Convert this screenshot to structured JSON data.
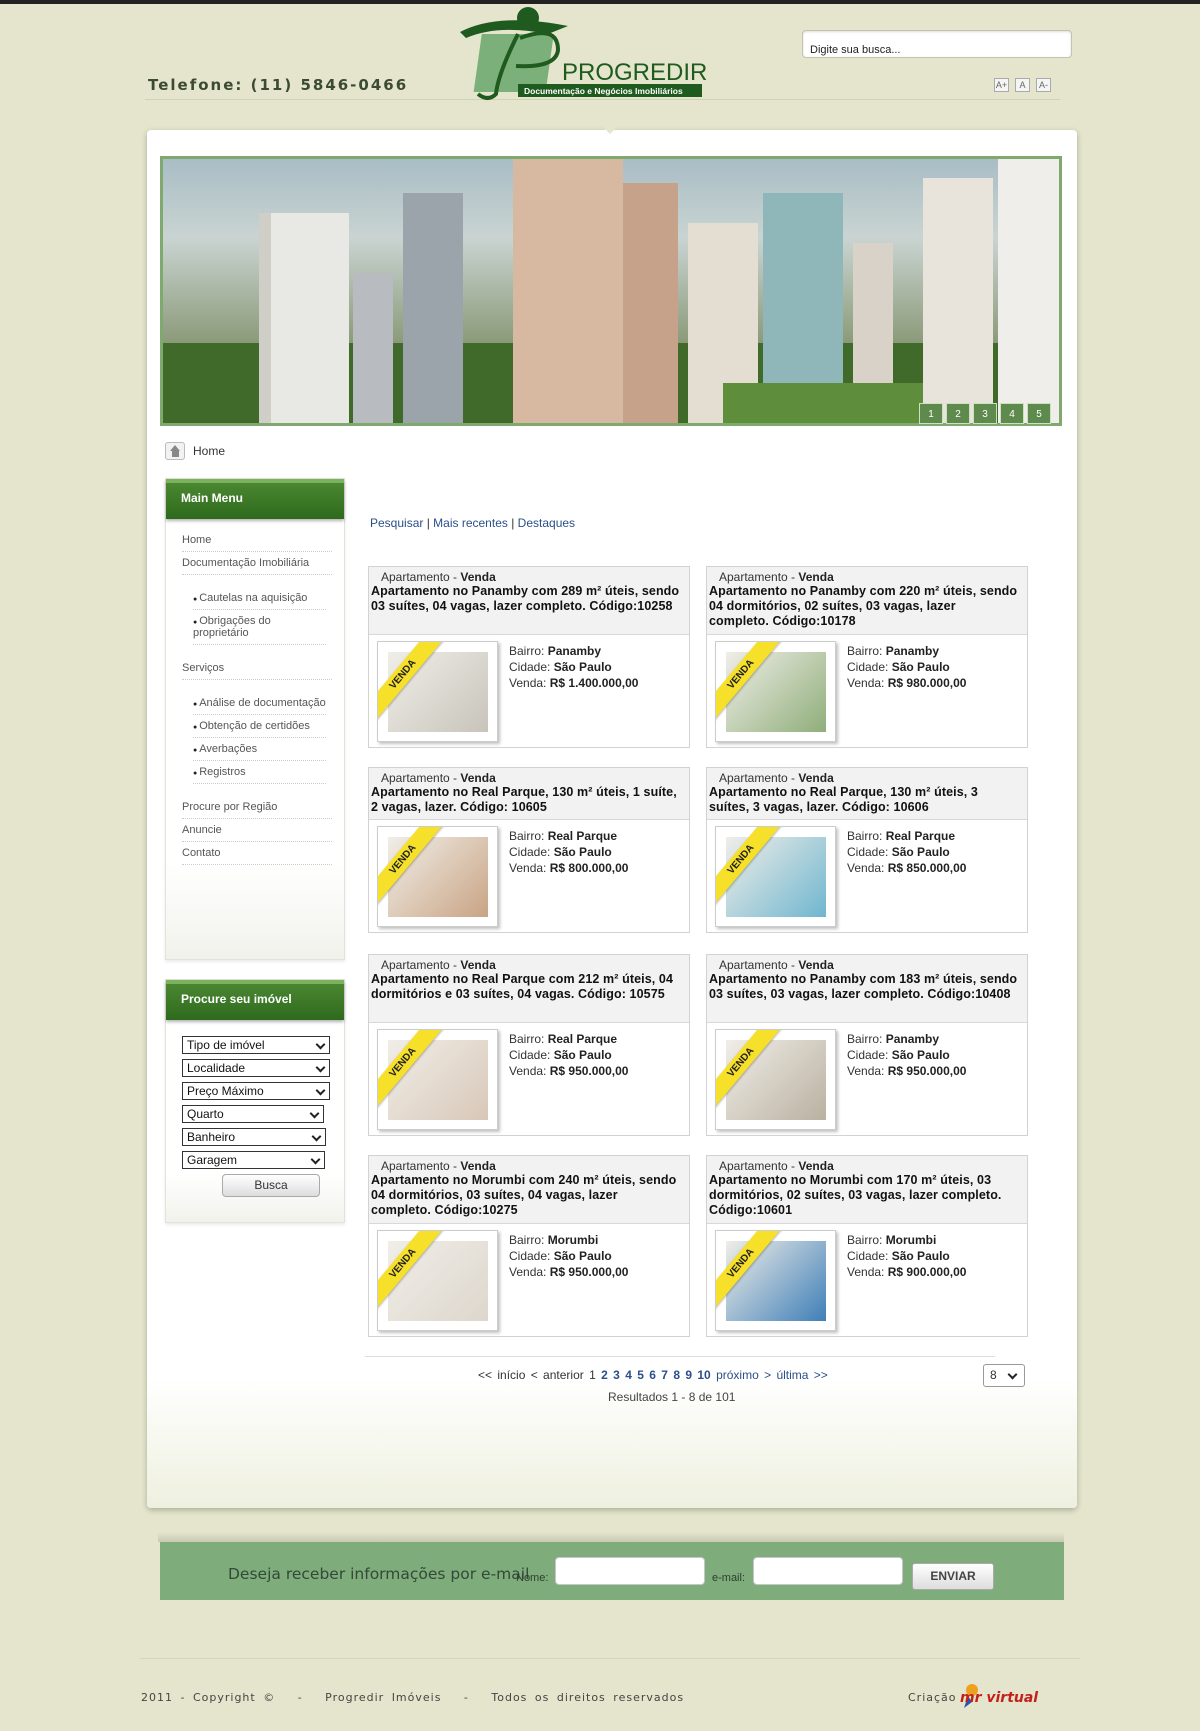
{
  "header": {
    "phone": "Telefone:  (11) 5846-0466",
    "logo_name": "PROGREDIR",
    "logo_tagline": "Documentação e Negócios Imobiliários",
    "search_placeholder": "Digite sua busca...",
    "font_buttons": [
      "A+",
      "A",
      "A-"
    ]
  },
  "banner": {
    "slides": [
      "1",
      "2",
      "3",
      "4",
      "5"
    ]
  },
  "breadcrumb": {
    "home": "Home"
  },
  "main_menu": {
    "title": "Main Menu",
    "items": [
      {
        "label": "Home",
        "sub": false
      },
      {
        "label": "Documentação Imobiliária",
        "sub": false
      },
      {
        "label": "Cautelas na aquisição",
        "sub": true
      },
      {
        "label": "Obrigações do proprietário",
        "sub": true
      },
      {
        "label": "Serviços",
        "sub": false
      },
      {
        "label": "Análise de documentação",
        "sub": true
      },
      {
        "label": "Obtenção de certidões",
        "sub": true
      },
      {
        "label": "Averbações",
        "sub": true
      },
      {
        "label": "Registros",
        "sub": true
      },
      {
        "label": "Procure por Região",
        "sub": false
      },
      {
        "label": "Anuncie",
        "sub": false
      },
      {
        "label": "Contato",
        "sub": false
      }
    ]
  },
  "search_panel": {
    "title": "Procure seu imóvel",
    "selects": [
      "Tipo de imóvel",
      "Localidade",
      "Preço Máximo",
      "Quarto",
      "Banheiro",
      "Garagem"
    ],
    "button": "Busca"
  },
  "tabs": [
    "Pesquisar",
    "Mais recentes",
    "Destaques"
  ],
  "ribbon_label": "VENDA",
  "listings": [
    {
      "type": "Apartamento",
      "deal": "Venda",
      "title": "Apartamento no Panamby com 289 m² úteis, sendo 03 suítes, 04 vagas, lazer completo. Código:10258",
      "bairro": "Panamby",
      "cidade": "São Paulo",
      "venda": "R$ 1.400.000,00",
      "img_color": "#c8c4bb"
    },
    {
      "type": "Apartamento",
      "deal": "Venda",
      "title": "Apartamento no Panamby com 220 m² úteis, sendo 04 dormitórios, 02 suítes, 03 vagas, lazer completo. Código:10178",
      "bairro": "Panamby",
      "cidade": "São Paulo",
      "venda": "R$ 980.000,00",
      "img_color": "#8fae7a"
    },
    {
      "type": "Apartamento",
      "deal": "Venda",
      "title": "Apartamento no Real Parque, 130 m² úteis, 1 suíte, 2 vagas, lazer. Código: 10605",
      "bairro": "Real Parque",
      "cidade": "São Paulo",
      "venda": "R$ 800.000,00",
      "img_color": "#c9a484"
    },
    {
      "type": "Apartamento",
      "deal": "Venda",
      "title": "Apartamento no Real Parque, 130 m² úteis, 3 suítes, 3 vagas, lazer. Código: 10606",
      "bairro": "Real Parque",
      "cidade": "São Paulo",
      "venda": "R$ 850.000,00",
      "img_color": "#6fb6cf"
    },
    {
      "type": "Apartamento",
      "deal": "Venda",
      "title": "Apartamento no Real Parque com 212 m² úteis, 04 dormitórios e 03 suítes, 04 vagas. Código: 10575",
      "bairro": "Real Parque",
      "cidade": "São Paulo",
      "venda": "R$ 950.000,00",
      "img_color": "#d8c7b8"
    },
    {
      "type": "Apartamento",
      "deal": "Venda",
      "title": "Apartamento no Panamby com 183 m² úteis, sendo 03 suítes, 03 vagas, lazer completo. Código:10408",
      "bairro": "Panamby",
      "cidade": "São Paulo",
      "venda": "R$ 950.000,00",
      "img_color": "#b9b0a0"
    },
    {
      "type": "Apartamento",
      "deal": "Venda",
      "title": "Apartamento no Morumbi com 240 m² úteis, sendo 04 dormitórios, 03 suítes, 04 vagas, lazer completo. Código:10275",
      "bairro": "Morumbi",
      "cidade": "São Paulo",
      "venda": "R$ 950.000,00",
      "img_color": "#ddd6cc"
    },
    {
      "type": "Apartamento",
      "deal": "Venda",
      "title": "Apartamento no Morumbi com 170 m² úteis, 03 dormitórios, 02 suítes, 03 vagas, lazer completo. Código:10601",
      "bairro": "Morumbi",
      "cidade": "São Paulo",
      "venda": "R$ 900.000,00",
      "img_color": "#3f7fb8"
    }
  ],
  "field_labels": {
    "bairro": "Bairro:",
    "cidade": "Cidade:",
    "venda": "Venda:"
  },
  "pagination": {
    "first": "<< início",
    "prev": "< anterior",
    "current": "1",
    "pages": [
      "2",
      "3",
      "4",
      "5",
      "6",
      "7",
      "8",
      "9",
      "10"
    ],
    "next": "próximo >",
    "last": "última >>",
    "results": "Resultados 1 - 8 de 101",
    "per_page": "8"
  },
  "newsletter": {
    "label": "Deseja receber informações por e-mail",
    "name_label": "Nome:",
    "email_label": "e-mail:",
    "button": "ENVIAR"
  },
  "footer": {
    "copyright": "2011 - Copyright ©   -   Progredir Imóveis   -   Todos os direitos reservados",
    "credit": "Criação",
    "credit_brand": "mr virtual"
  }
}
